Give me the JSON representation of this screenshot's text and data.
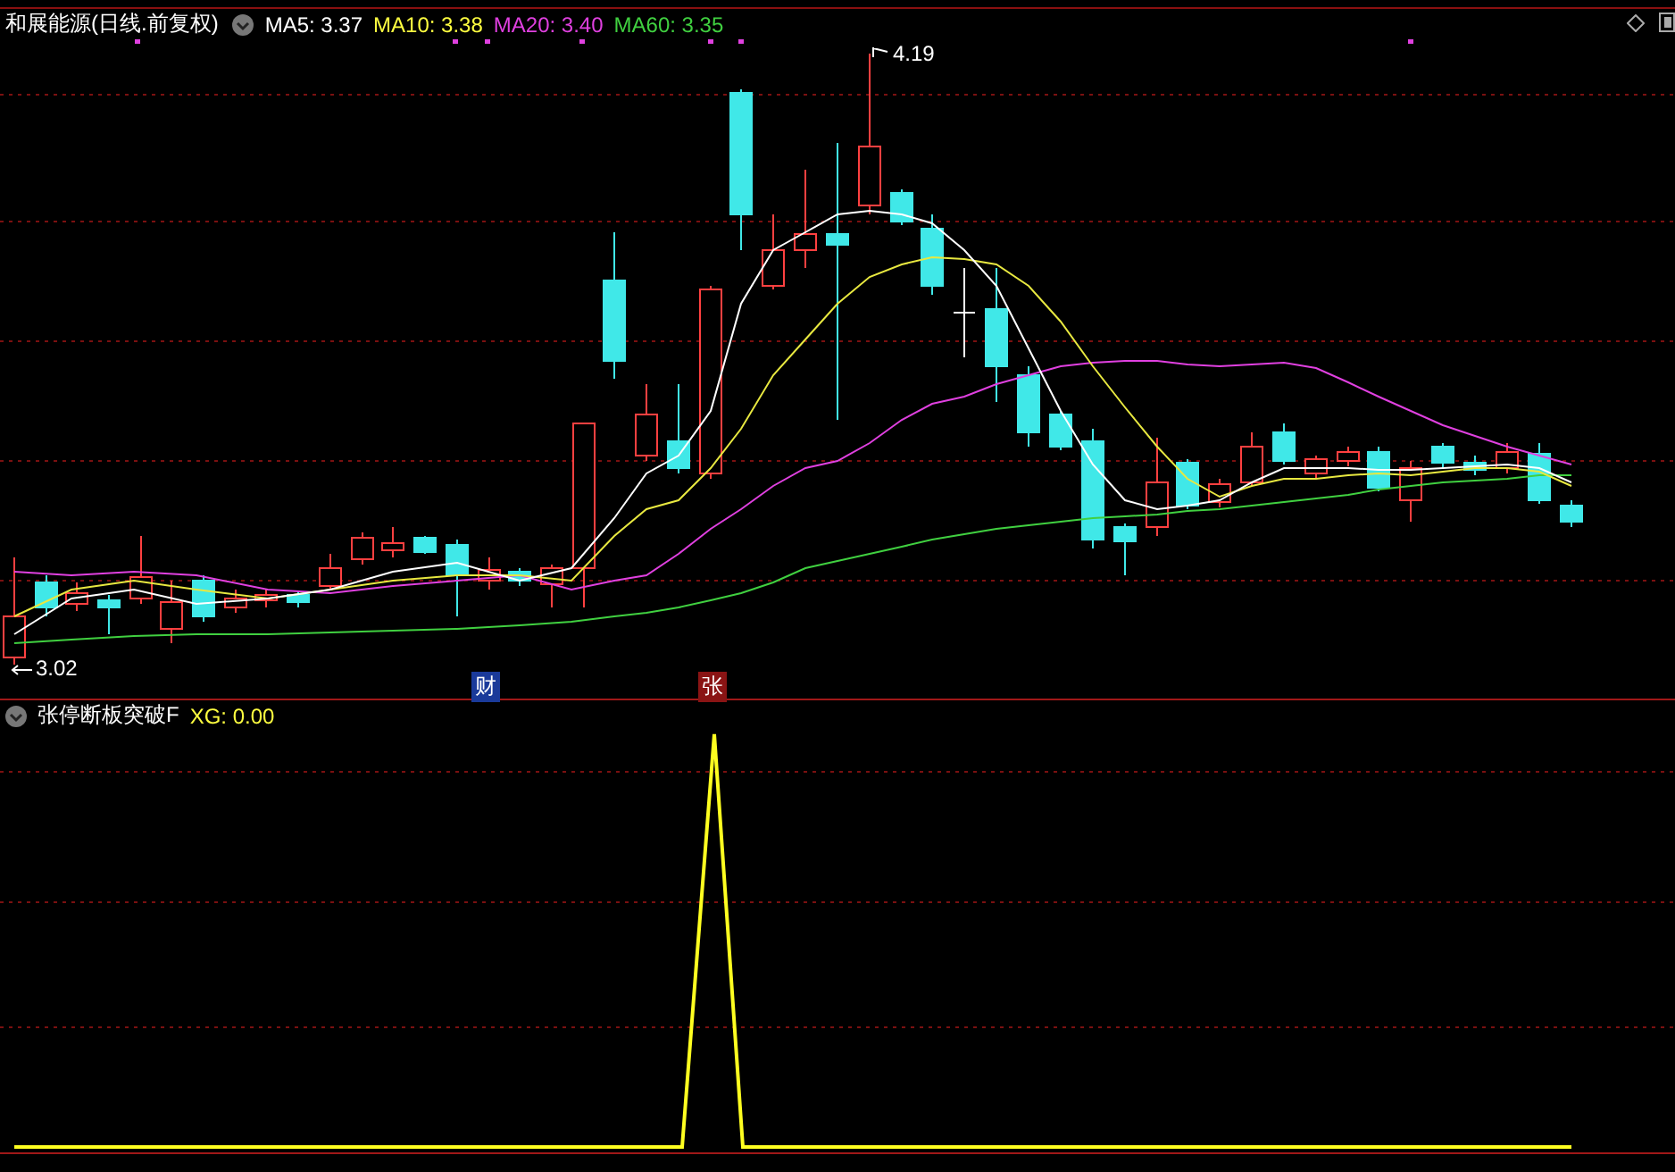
{
  "header": {
    "title": "和展能源(日线.前复权)",
    "averages": [
      {
        "label": "MA5: 3.37",
        "color": "#ffffff"
      },
      {
        "label": "MA10: 3.38",
        "color": "#ffff40"
      },
      {
        "label": "MA20: 3.40",
        "color": "#e040e0"
      },
      {
        "label": "MA60: 3.35",
        "color": "#40d040"
      }
    ]
  },
  "price_marks": {
    "high": "4.19",
    "low": "3.02"
  },
  "event_tags": [
    {
      "text": "财",
      "kind": "finance"
    },
    {
      "text": "张",
      "kind": "limit"
    }
  ],
  "indicator": {
    "name": "张停断板突破F",
    "reading": "XG: 0.00"
  }
}
